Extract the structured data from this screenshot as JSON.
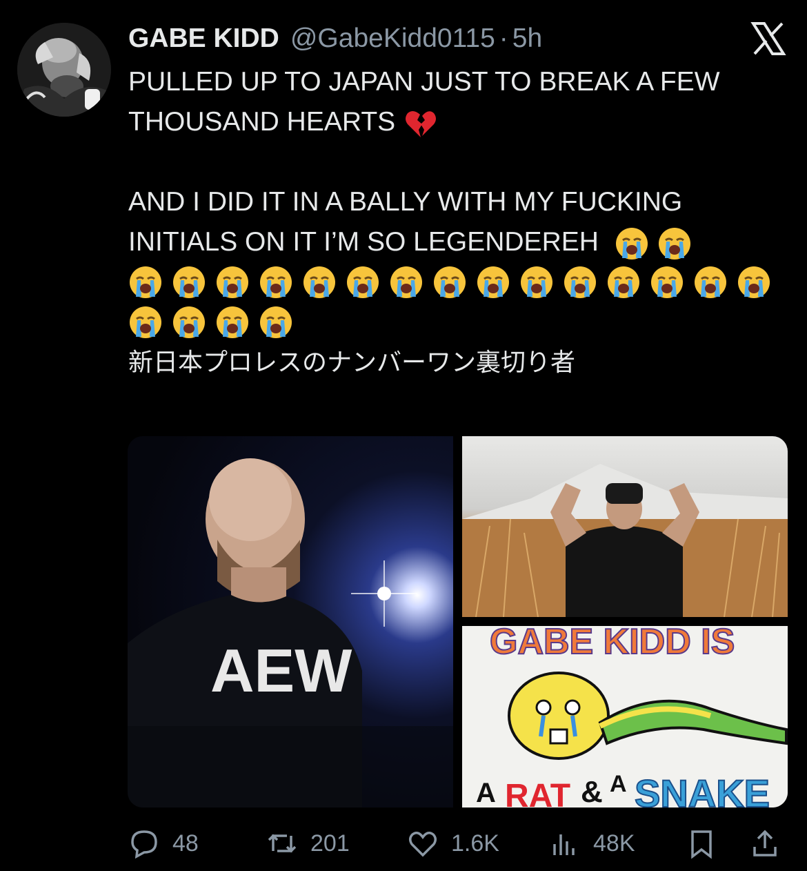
{
  "author": {
    "name": "GABE KIDD",
    "handle": "@GabeKidd0115",
    "separator": "·",
    "time": "5h",
    "avatar_icon": "avatar-photo"
  },
  "tweet": {
    "line1": "PULLED UP TO JAPAN JUST TO BREAK A FEW THOUSAND HEARTS",
    "line1_emoji": "broken-heart",
    "line2": "AND I DID IT IN A BALLY WITH MY FUCKING INITIALS ON IT I’M SO LEGENDEREH",
    "crying_emoji_count": 21,
    "line3": "新日本プロレスのナンバーワン裏切り者"
  },
  "media": {
    "images": [
      {
        "alt_icon": "wrestler-aew-shirt-photo",
        "shirt_text": "AEW"
      },
      {
        "alt_icon": "wrestler-flexing-mountain-photo"
      },
      {
        "alt_icon": "fan-sign-photo",
        "sign_top": "GABE KIDD IS",
        "sign_a1": "A",
        "sign_rat": "RAT",
        "sign_amp": "&",
        "sign_a2": "A",
        "sign_snake": "SNAKE"
      }
    ]
  },
  "actions": {
    "replies": "48",
    "retweets": "201",
    "likes": "1.6K",
    "views": "48K"
  },
  "colors": {
    "background": "#000000",
    "text": "#e7e9ea",
    "muted": "#8b98a5"
  }
}
